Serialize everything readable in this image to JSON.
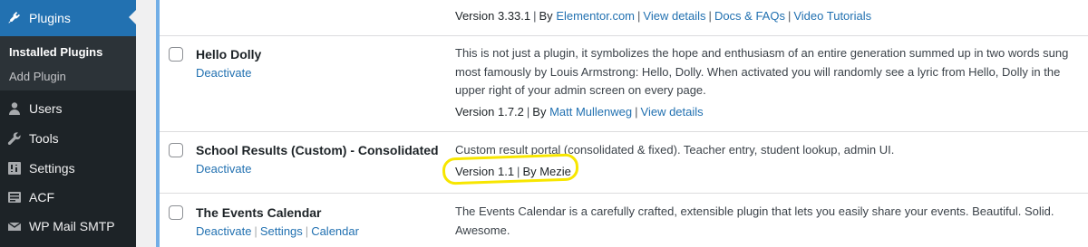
{
  "sidebar": {
    "items": [
      {
        "label": "Plugins",
        "icon": "plugin-icon"
      },
      {
        "label": "Users",
        "icon": "users-icon"
      },
      {
        "label": "Tools",
        "icon": "tools-icon"
      },
      {
        "label": "Settings",
        "icon": "settings-icon"
      },
      {
        "label": "ACF",
        "icon": "acf-icon"
      },
      {
        "label": "WP Mail SMTP",
        "icon": "mail-icon"
      }
    ],
    "submenu": [
      "Installed Plugins",
      "Add Plugin"
    ]
  },
  "plugins": [
    {
      "meta": {
        "version": "Version 3.33.1",
        "by": "By",
        "author": "Elementor.com",
        "links": [
          "View details",
          "Docs & FAQs",
          "Video Tutorials"
        ]
      }
    },
    {
      "name": "Hello Dolly",
      "actions": [
        "Deactivate"
      ],
      "description": "This is not just a plugin, it symbolizes the hope and enthusiasm of an entire generation summed up in two words sung most famously by Louis Armstrong: Hello, Dolly. When activated you will randomly see a lyric from Hello, Dolly in the upper right of your admin screen on every page.",
      "meta": {
        "version": "Version 1.7.2",
        "by": "By",
        "author": "Matt Mullenweg",
        "links": [
          "View details"
        ]
      }
    },
    {
      "name": "School Results (Custom) - Consolidated",
      "actions": [
        "Deactivate"
      ],
      "description": "Custom result portal (consolidated & fixed). Teacher entry, student lookup, admin UI.",
      "meta": {
        "version": "Version 1.1",
        "by": "By Mezie"
      }
    },
    {
      "name": "The Events Calendar",
      "actions": [
        "Deactivate",
        "Settings",
        "Calendar"
      ],
      "description": "The Events Calendar is a carefully crafted, extensible plugin that lets you easily share your events. Beautiful. Solid. Awesome."
    }
  ],
  "colors": {
    "accent": "#2271b1",
    "sidebar": "#1d2327",
    "active_border": "#72aee6",
    "annotation": "#f7e600"
  }
}
